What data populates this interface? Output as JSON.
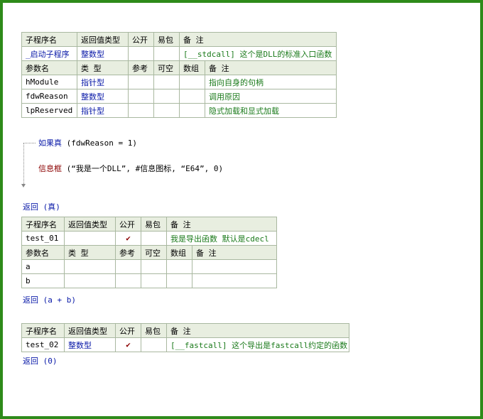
{
  "table1": {
    "header": [
      "子程序名",
      "返回值类型",
      "公开",
      "易包",
      "备 注"
    ],
    "row": [
      "_启动子程序",
      "整数型",
      "",
      "",
      "[__stdcall] 这个是DLL的标准入口函数"
    ],
    "param_header": [
      "参数名",
      "类 型",
      "参考",
      "可空",
      "数组",
      "备 注"
    ],
    "params": [
      [
        "hModule",
        "指针型",
        "",
        "",
        "",
        "指向自身的句柄"
      ],
      [
        "fdwReason",
        "整数型",
        "",
        "",
        "",
        "调用原因"
      ],
      [
        "lpReserved",
        "指针型",
        "",
        "",
        "",
        "隐式加载和显式加载"
      ]
    ]
  },
  "code": {
    "if_keyword": "如果真",
    "if_args": "(fdwReason = 1)",
    "msgbox_keyword": "信息框",
    "msgbox_args": "(“我是一个DLL”, #信息图标, “E64”, 0)",
    "return1": "返回 (真)"
  },
  "table2": {
    "header": [
      "子程序名",
      "返回值类型",
      "公开",
      "易包",
      "备 注"
    ],
    "row": [
      "test_01",
      "",
      "✔",
      "",
      "我是导出函数 默认是cdecl"
    ],
    "param_header": [
      "参数名",
      "类 型",
      "参考",
      "可空",
      "数组",
      "备 注"
    ],
    "params": [
      [
        "a",
        "",
        "",
        "",
        "",
        ""
      ],
      [
        "b",
        "",
        "",
        "",
        "",
        ""
      ]
    ],
    "return": "返回 (a + b)"
  },
  "table3": {
    "header": [
      "子程序名",
      "返回值类型",
      "公开",
      "易包",
      "备 注"
    ],
    "row": [
      "test_02",
      "整数型",
      "✔",
      "",
      "[__fastcall] 这个导出是fastcall约定的函数"
    ],
    "return": "返回 (0)"
  },
  "colors": {
    "frame": "#2e8b1a",
    "header_bg": "#e8eee0",
    "type_blue": "#0a1aa8",
    "comment_green": "#1a7a1a",
    "keyword_red": "#8b0000"
  }
}
